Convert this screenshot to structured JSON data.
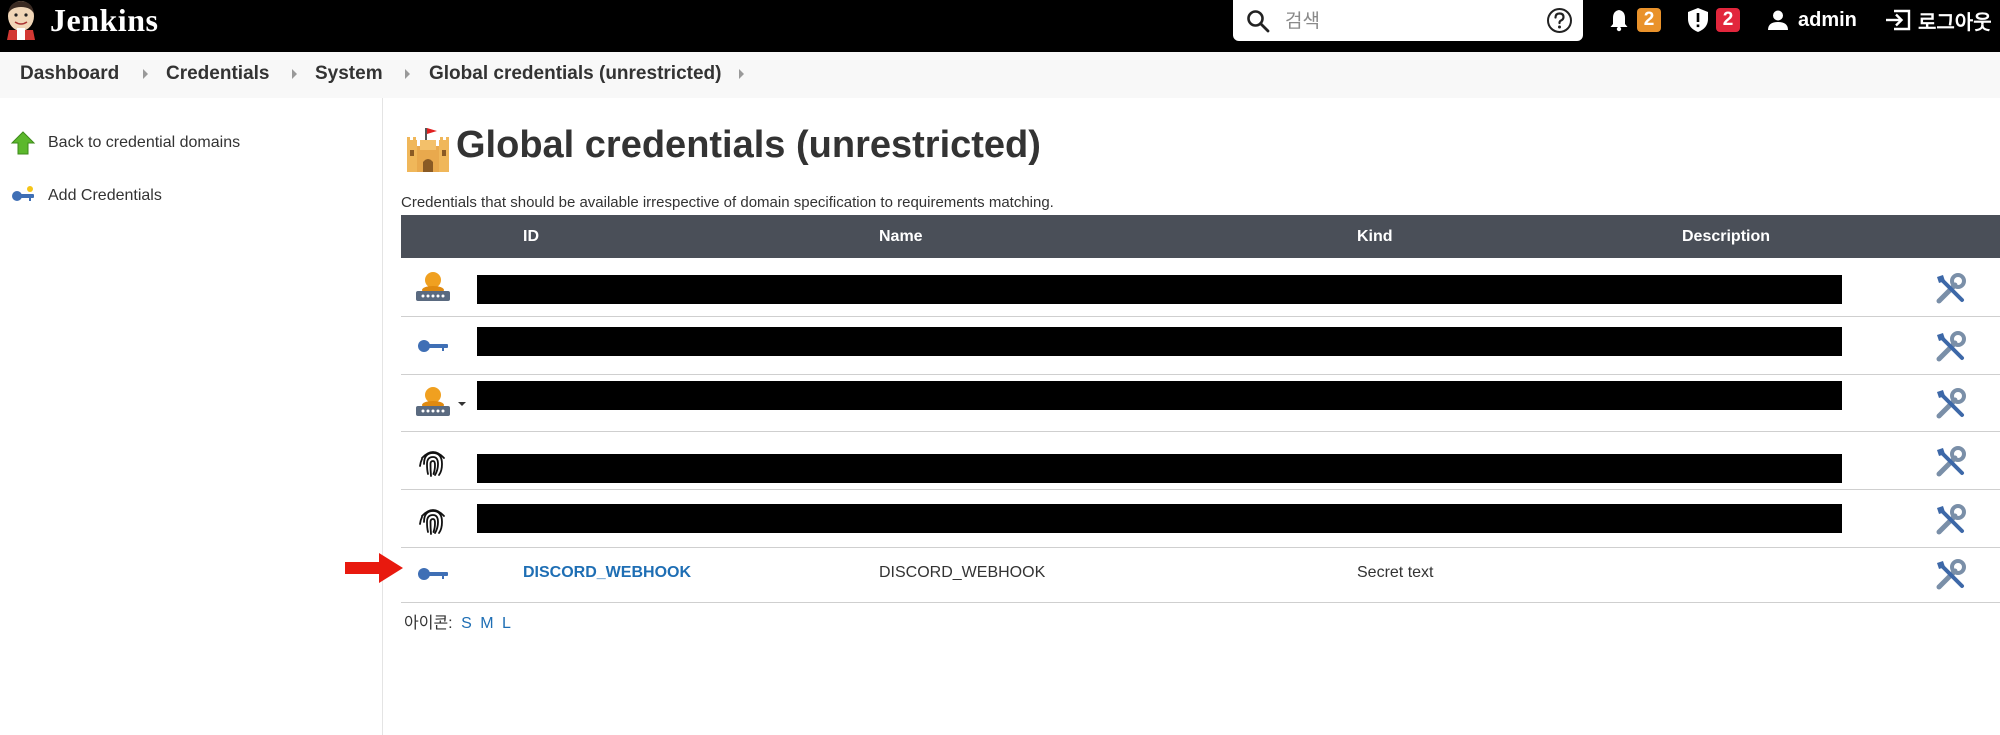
{
  "header": {
    "brand": "Jenkins",
    "search": {
      "placeholder": "검색",
      "value": ""
    },
    "notifications": {
      "count": "2",
      "color": "#e9922b"
    },
    "security": {
      "count": "2",
      "color": "#e2263c"
    },
    "user": "admin",
    "logout": "로그아웃"
  },
  "breadcrumb": [
    {
      "label": "Dashboard"
    },
    {
      "label": "Credentials"
    },
    {
      "label": "System"
    },
    {
      "label": "Global credentials (unrestricted)"
    }
  ],
  "sidebar": {
    "items": [
      {
        "label": "Back to credential domains",
        "icon": "up-arrow-icon"
      },
      {
        "label": "Add Credentials",
        "icon": "key-icon"
      }
    ]
  },
  "main": {
    "title": "Global credentials (unrestricted)",
    "title_icon": "castle-icon",
    "description": "Credentials that should be available irrespective of domain specification to requirements matching.",
    "columns": [
      "ID",
      "Name",
      "Kind",
      "Description"
    ],
    "rows": [
      {
        "icon": "user-password-icon",
        "redacted": true
      },
      {
        "icon": "key-icon",
        "redacted": true
      },
      {
        "icon": "user-password-icon",
        "redacted": true
      },
      {
        "icon": "fingerprint-icon",
        "redacted": true
      },
      {
        "icon": "fingerprint-icon",
        "redacted": true
      },
      {
        "icon": "key-icon",
        "id": "DISCORD_WEBHOOK",
        "name": "DISCORD_WEBHOOK",
        "kind": "Secret text",
        "description": "",
        "highlighted": true
      }
    ],
    "icon_size": {
      "label": "아이콘:",
      "options": [
        "S",
        "M",
        "L"
      ]
    }
  },
  "colors": {
    "header_bg": "#000000",
    "table_header_bg": "#4a4f58",
    "link": "#1e6eb4",
    "highlight_arrow": "#e8190e"
  }
}
